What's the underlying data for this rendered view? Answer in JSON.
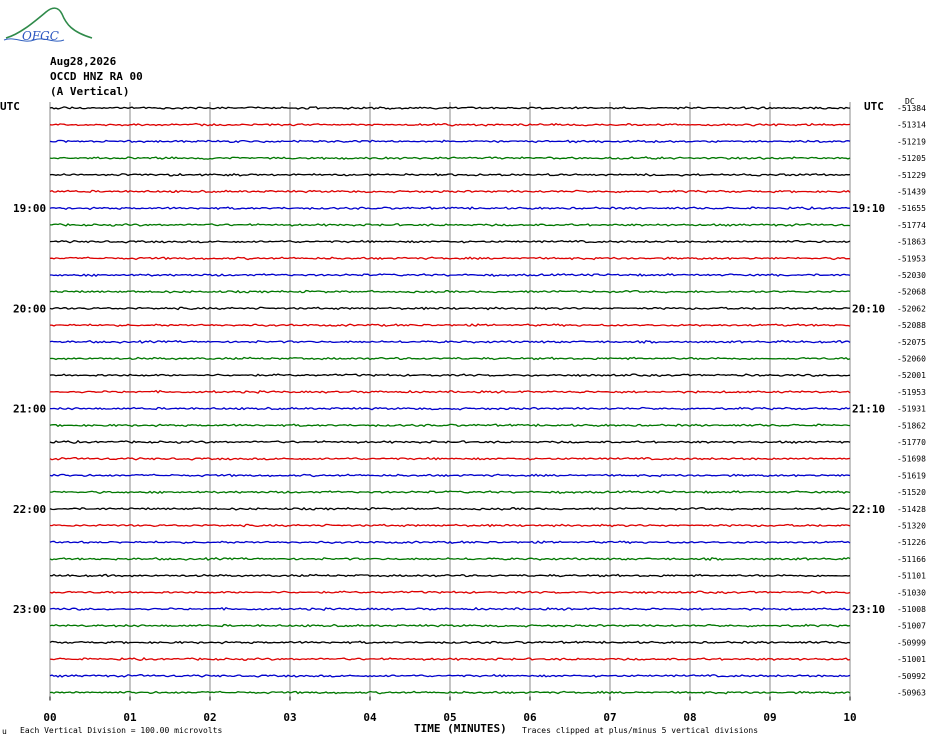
{
  "header": {
    "logo_text": "OFGC",
    "date": "Aug28,2026",
    "station": "OCCD HNZ RA 00",
    "component": "(A Vertical)"
  },
  "colors": {
    "cycle": [
      "#000000",
      "#dd0000",
      "#0000cc",
      "#007700"
    ],
    "grid": "#888888"
  },
  "chart_data": {
    "type": "line",
    "left_label": "UTC",
    "right_label": "UTC",
    "dc_label": "DC",
    "xlabel": "TIME (MINUTES)",
    "x_ticks": [
      "00",
      "01",
      "02",
      "03",
      "04",
      "05",
      "06",
      "07",
      "08",
      "09",
      "10"
    ],
    "xlim": [
      0,
      10
    ],
    "left_hour_labels": [
      {
        "row": 6,
        "text": "19:00"
      },
      {
        "row": 12,
        "text": "20:00"
      },
      {
        "row": 18,
        "text": "21:00"
      },
      {
        "row": 24,
        "text": "22:00"
      },
      {
        "row": 30,
        "text": "23:00"
      }
    ],
    "right_hour_labels": [
      {
        "row": 6,
        "text": "19:10"
      },
      {
        "row": 12,
        "text": "20:10"
      },
      {
        "row": 18,
        "text": "21:10"
      },
      {
        "row": 24,
        "text": "22:10"
      },
      {
        "row": 30,
        "text": "23:10"
      }
    ],
    "dc_values": [
      -51384,
      -51314,
      -51219,
      -51205,
      -51229,
      -51439,
      -51655,
      -51774,
      -51863,
      -51953,
      -52030,
      -52068,
      -52062,
      -52088,
      -52075,
      -52060,
      -52001,
      -51953,
      -51931,
      -51862,
      -51770,
      -51698,
      -51619,
      -51520,
      -51428,
      -51320,
      -51226,
      -51166,
      -51101,
      -51030,
      -51008,
      -51007,
      -50999,
      -51001,
      -50992,
      -50963
    ],
    "footer_left": "Each Vertical Division =  100.00 microvolts",
    "footer_right": "Traces clipped at plus/minus 5 vertical divisions",
    "corner_mark": "u"
  }
}
